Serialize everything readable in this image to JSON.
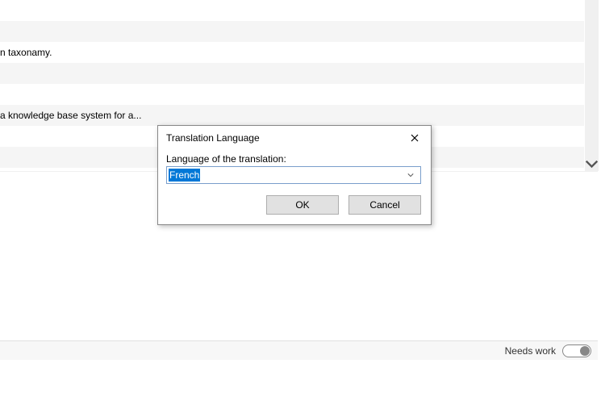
{
  "list": {
    "rows": [
      "",
      "",
      "n taxonamy.",
      "",
      "",
      "a knowledge base system for a...",
      "",
      ""
    ]
  },
  "status": {
    "needs_work_label": "Needs work"
  },
  "dialog": {
    "title": "Translation Language",
    "field_label": "Language of the translation:",
    "value": "French",
    "ok_label": "OK",
    "cancel_label": "Cancel"
  }
}
